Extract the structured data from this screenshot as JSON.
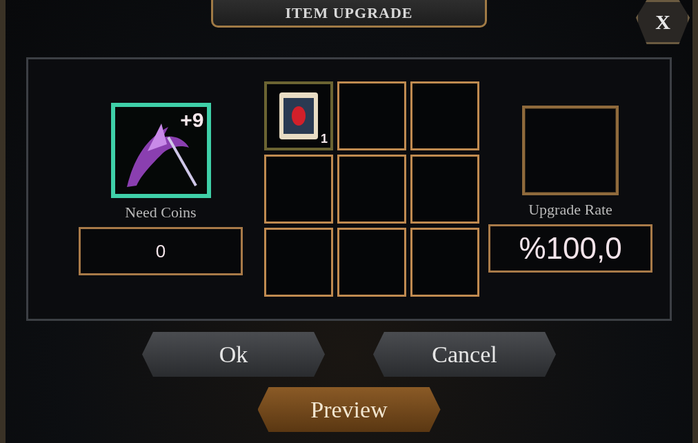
{
  "window": {
    "title": "ITEM UPGRADE",
    "close": "X"
  },
  "target": {
    "level": "+9",
    "label": "Need Coins",
    "value": "0"
  },
  "slots": [
    {
      "kind": "scroll",
      "count": "1"
    },
    {
      "kind": "empty"
    },
    {
      "kind": "empty"
    },
    {
      "kind": "empty"
    },
    {
      "kind": "empty"
    },
    {
      "kind": "empty"
    },
    {
      "kind": "empty"
    },
    {
      "kind": "empty"
    },
    {
      "kind": "empty"
    }
  ],
  "result": {
    "label": "Upgrade Rate",
    "value": "%100,0"
  },
  "buttons": [
    {
      "label": "Ok",
      "kind": "grey"
    },
    {
      "label": "Cancel",
      "kind": "grey"
    },
    {
      "label": "Preview",
      "kind": "gold"
    }
  ]
}
